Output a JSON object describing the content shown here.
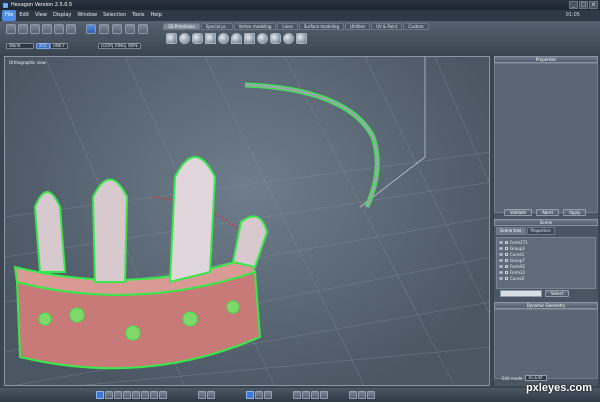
{
  "window": {
    "title": "Hexagon Version 2.5.0.5",
    "clock": "01:05"
  },
  "menu": [
    "File",
    "Edit",
    "View",
    "Display",
    "Window",
    "Selection",
    "Tools",
    "Help"
  ],
  "toolbar_tabs": [
    "3D Primitives",
    "Special pr..",
    "Vertex modeling",
    "Lines",
    "Surface modeling",
    "Utilities",
    "UV & Paint",
    "Custom"
  ],
  "toolbar": {
    "coord_system": "World",
    "chips": [
      "XYZ",
      "UNIFY",
      "LOOP",
      "RING",
      "WIPE"
    ]
  },
  "viewport": {
    "label": "Orthographic view"
  },
  "panels": {
    "properties_title": "Properties",
    "properties_buttons": [
      "Validate",
      "Abort",
      "Apply"
    ],
    "scene_title": "Scene",
    "scene_tabs": [
      "Scene tree",
      "Properties"
    ],
    "scene_items": [
      "Form271",
      "Group3",
      "Curve1",
      "Group7",
      "Form61",
      "Form22",
      "Curve2"
    ],
    "select_button": "Select",
    "dynamic_title": "Dynamic Geometry",
    "edit_mode_label": "Edit mode",
    "edit_mode_value": "Au.Edit"
  },
  "watermark": "pxleyes.com",
  "colors": {
    "accent": "#4d8fe8",
    "wire": "#39e84a",
    "mesh": "#c77a78"
  }
}
